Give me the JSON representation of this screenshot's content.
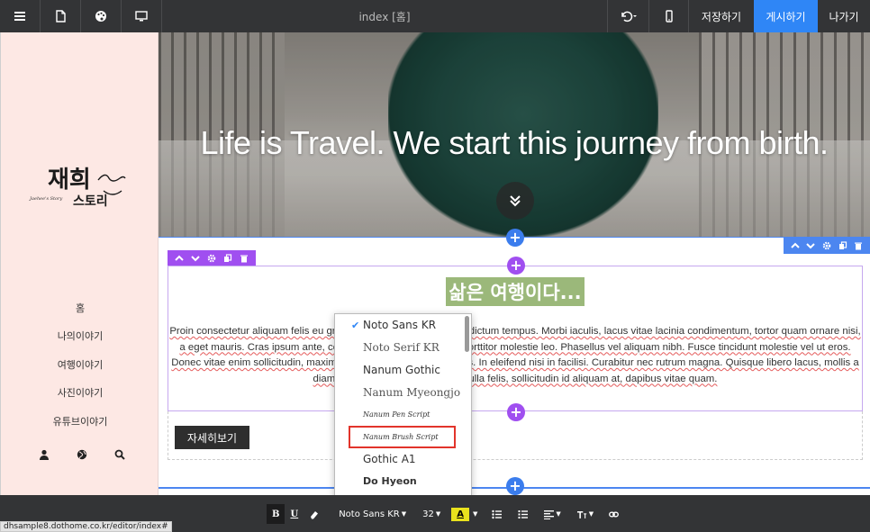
{
  "topbar": {
    "title": "index [홈]",
    "save_label": "저장하기",
    "publish_label": "게시하기",
    "exit_label": "나가기",
    "icons": [
      "menu-icon",
      "page-icon",
      "palette-icon",
      "monitor-icon",
      "undo-icon",
      "mobile-icon"
    ]
  },
  "sidebar": {
    "logo_main": "재희",
    "logo_sub": "스토리",
    "logo_tag": "Jaehee's Story",
    "menu": [
      {
        "label": "홈"
      },
      {
        "label": "나의이야기"
      },
      {
        "label": "여행이야기"
      },
      {
        "label": "사진이야기"
      },
      {
        "label": "유튜브이야기"
      }
    ],
    "icons": [
      "user-icon",
      "globe-icon",
      "search-icon"
    ]
  },
  "hero": {
    "text": "Life is Travel. We start this journey from birth."
  },
  "section": {
    "heading": "삶은 여행이다...",
    "paragraph": "Proin consectetur aliquam felis eu gravida placerat. Donec auctor dictum tempus. Morbi iaculis, lacus vitae lacinia condimentum, tortor quam ornare nisi, a eget mauris. Cras ipsum ante, condimentum eu ipsum eget, porttitor molestie leo. Phasellus vel aliquam nibh. Fusce tincidunt molestie vel ut eros. Donec vitae enim sollicitudin, maximus nisi gravida, placerat purus. In eleifend nisi in facilisi. Curabitur nec rutrum magna. Quisque libero lacus, mollis a diam et, accumsan mi, vulputate nulla felis, sollicitudin id aliquam at, dapibus vitae quam.",
    "button_label": "자세히보기"
  },
  "font_dropdown": {
    "selected": "Noto Sans KR",
    "highlighted": "Nanum Brush Script",
    "options": [
      {
        "label": "Noto Sans KR",
        "style": "sans",
        "checked": true
      },
      {
        "label": "Noto Serif KR",
        "style": "serif"
      },
      {
        "label": "Nanum Gothic",
        "style": "sans"
      },
      {
        "label": "Nanum Myeongjo",
        "style": "serif"
      },
      {
        "label": "Nanum Pen Script",
        "style": "script"
      },
      {
        "label": "Nanum Brush Script",
        "style": "script",
        "highlight": true
      },
      {
        "label": "Gothic A1",
        "style": "sans"
      },
      {
        "label": "Do Hyeon",
        "style": "bold"
      }
    ]
  },
  "format_bar": {
    "bold": "B",
    "underline": "U",
    "font": "Noto Sans KR",
    "size": "32",
    "color_letter": "A"
  },
  "status_url": "dhsample8.dothome.co.kr/editor/index#",
  "colors": {
    "topbar_bg": "#333436",
    "publish_bg": "#2f86f6",
    "sidebar_bg": "#fde8e4",
    "heading_bg": "#9bb87a",
    "row_selection": "#4c86f0",
    "column_selection": "#a04ff0",
    "highlight_outline": "#e2342b"
  }
}
